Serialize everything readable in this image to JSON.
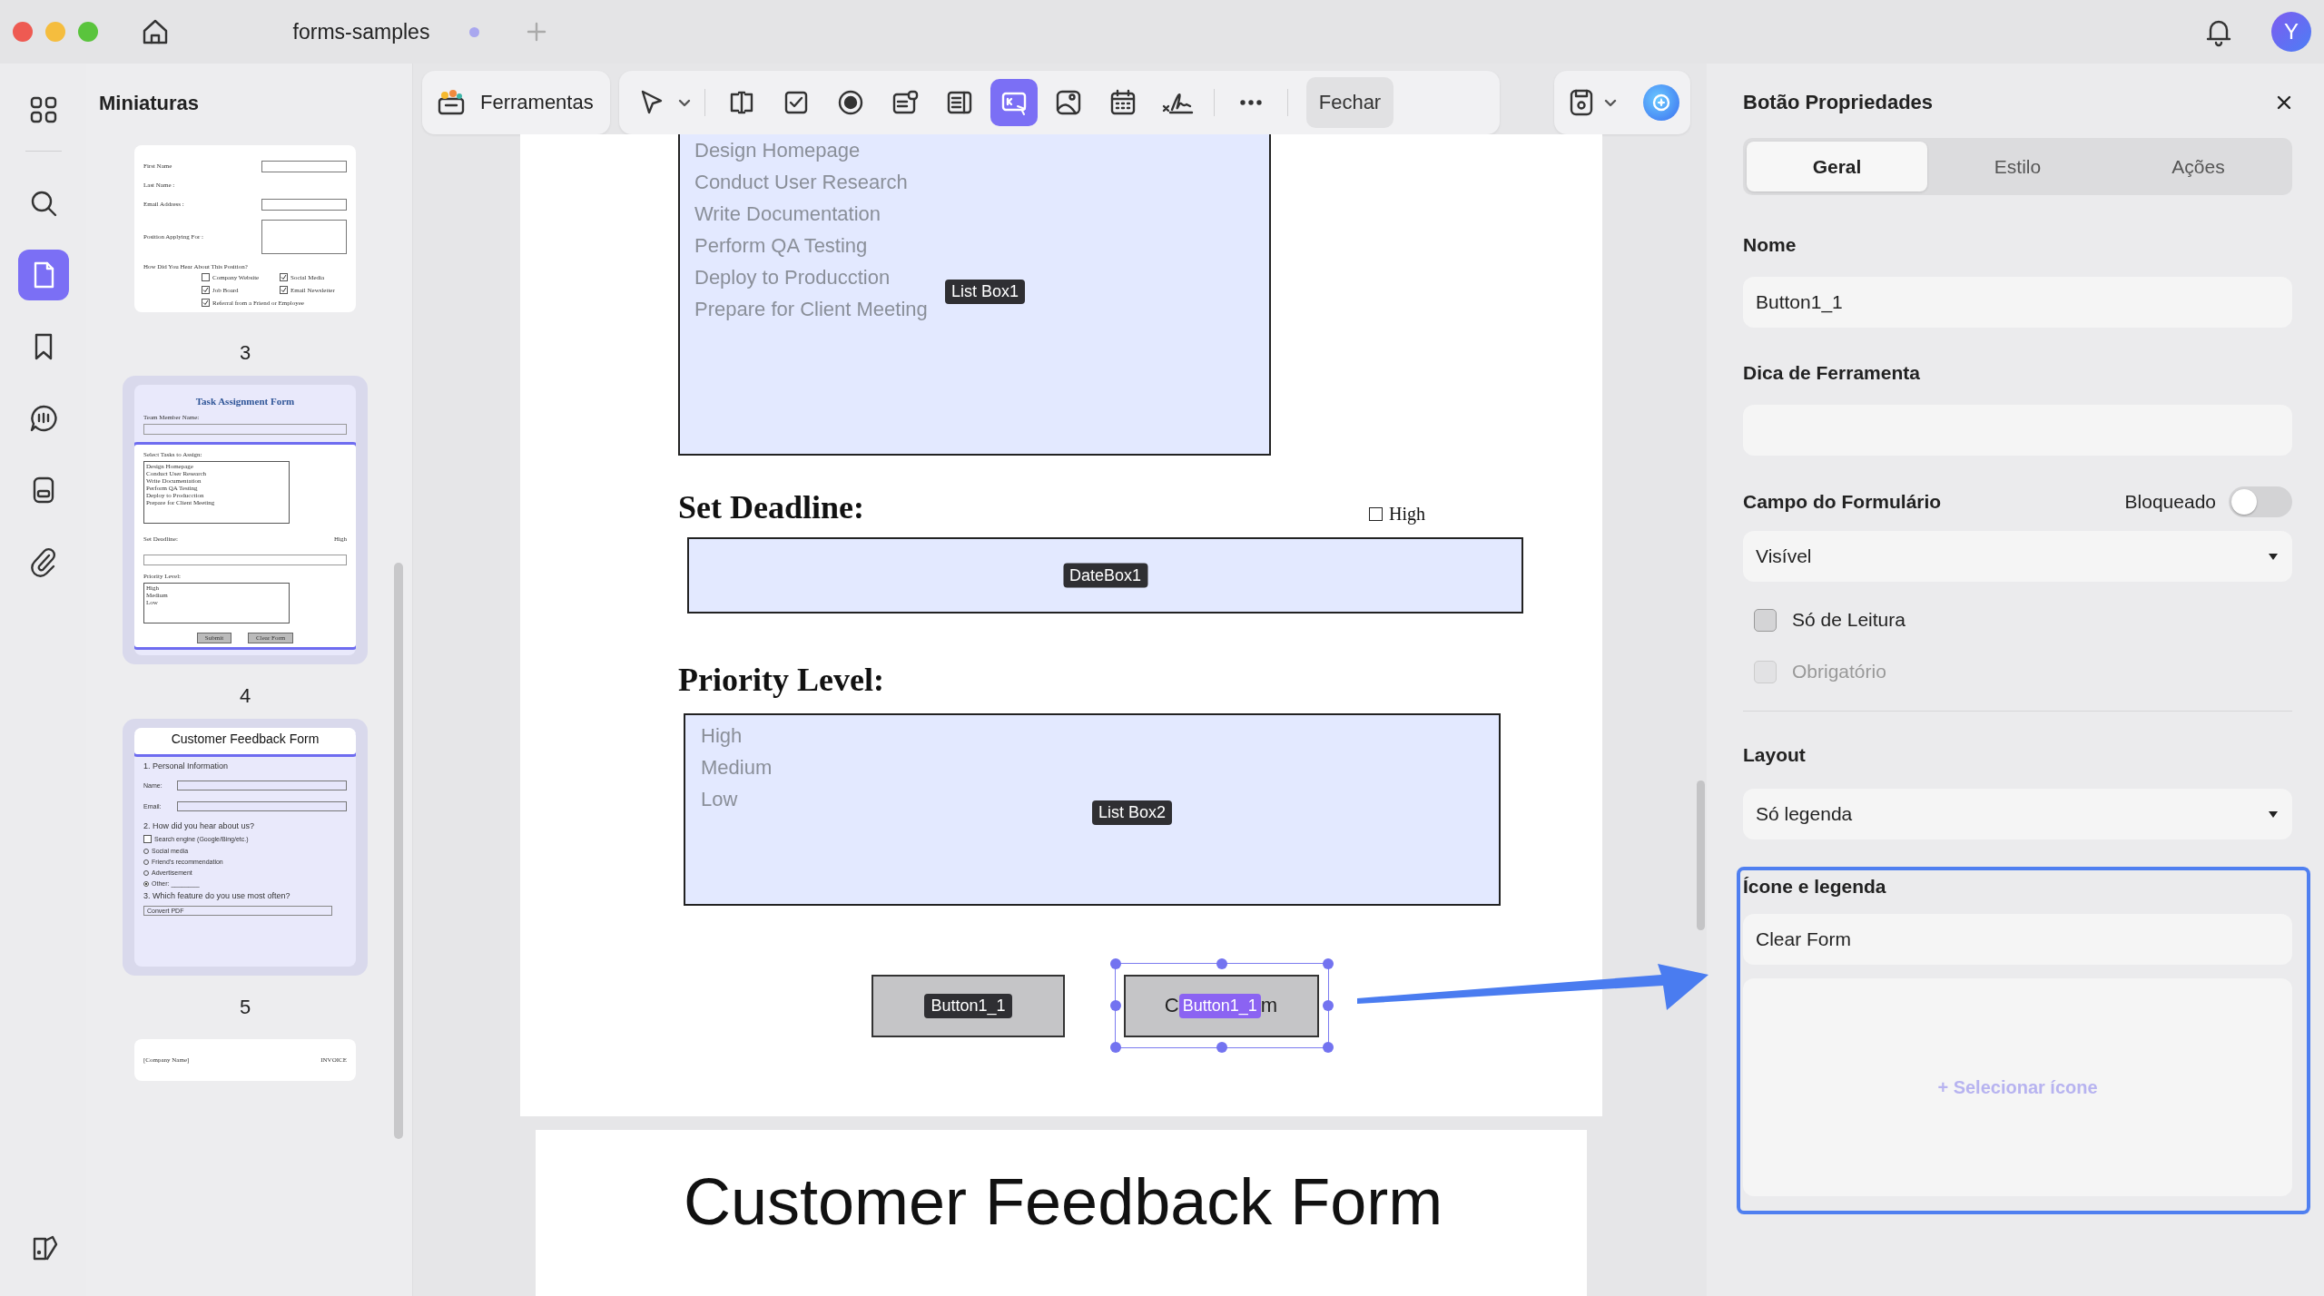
{
  "window": {
    "tab_title": "forms-samples",
    "modified": true,
    "avatar_initial": "Y"
  },
  "rail_items": [
    {
      "selected": false
    },
    {
      "selected": false
    },
    {
      "selected": true
    },
    {
      "selected": false
    },
    {
      "selected": false
    },
    {
      "selected": false
    },
    {
      "selected": false
    },
    {
      "selected": false
    }
  ],
  "thumbnails": {
    "title": "Miniaturas",
    "pages": [
      {
        "number": "3",
        "selected": false,
        "sections": [
          {
            "in_view": false,
            "items": [
              {
                "kind": "field_row",
                "text": "First Name"
              },
              {
                "kind": "text",
                "text": "Last Name :"
              },
              {
                "kind": "field_row",
                "text": "Email Address :"
              },
              {
                "kind": "area_row",
                "text": "Position Applying For :"
              },
              {
                "kind": "text",
                "text": "How Did You Hear About This Position?"
              },
              {
                "kind": "checks",
                "items": [
                  {
                    "text": "Company Website",
                    "checked": false
                  },
                  {
                    "text": "Social Media",
                    "checked": true
                  },
                  {
                    "text": "Job Board",
                    "checked": true
                  },
                  {
                    "text": "Email Newsletter",
                    "checked": true
                  },
                  {
                    "text": "Referral from a Friend or Employee",
                    "checked": true
                  }
                ]
              }
            ]
          }
        ]
      },
      {
        "number": "4",
        "selected": true,
        "sections": [
          {
            "in_view": false,
            "items": [
              {
                "kind": "title",
                "text": "Task Assignment Form"
              },
              {
                "kind": "text",
                "text": "Team Member Name:"
              },
              {
                "kind": "field"
              }
            ]
          },
          {
            "in_view": true,
            "items": [
              {
                "kind": "text",
                "text": "Select Tasks to Assign:"
              },
              {
                "kind": "listbox",
                "options": [
                  "Design Homepage",
                  "Conduct User Research",
                  "Write Documentation",
                  "Perform QA Testing",
                  "Deploy to Producction",
                  "Prepare for Client Meeting"
                ]
              },
              {
                "kind": "text_aside",
                "text": "Set Deadline:",
                "aside": "High"
              },
              {
                "kind": "field"
              },
              {
                "kind": "text",
                "text": "Priority Level:"
              },
              {
                "kind": "listbox",
                "options": [
                  "High",
                  "Medium",
                  "Low"
                ]
              },
              {
                "kind": "buttons",
                "labels": [
                  "Submit",
                  "Clear Form"
                ]
              }
            ]
          }
        ]
      },
      {
        "number": "5",
        "selected": true,
        "sections": [
          {
            "in_view": true,
            "items": [
              {
                "kind": "title",
                "text": "Customer Feedback Form"
              }
            ]
          },
          {
            "in_view": false,
            "items": [
              {
                "kind": "section",
                "text": "1. Personal Information"
              },
              {
                "kind": "field_row",
                "text": "Name:"
              },
              {
                "kind": "field_row",
                "text": "Email:"
              },
              {
                "kind": "section",
                "text": "2. How did you hear about us?"
              },
              {
                "kind": "check",
                "text": "Search engine (Google/Bing/etc.)",
                "checked": false
              },
              {
                "kind": "radio",
                "text": "Social media",
                "checked": false
              },
              {
                "kind": "radio",
                "text": "Friend's recommendation",
                "checked": false
              },
              {
                "kind": "radio",
                "text": "Advertisement",
                "checked": false
              },
              {
                "kind": "radio",
                "text": "Other: ________",
                "checked": true
              },
              {
                "kind": "section",
                "text": "3. Which feature do you use most often?"
              },
              {
                "kind": "dropdown",
                "text": "Convert PDF"
              }
            ]
          }
        ]
      },
      {
        "selected": false,
        "sections": [
          {
            "in_view": false,
            "items": [
              {
                "kind": "text_aside",
                "text": "[Company Name]",
                "aside": "INVOICE"
              }
            ]
          }
        ]
      }
    ]
  },
  "toolbar": {
    "tools_label": "Ferramentas",
    "tools": [
      {
        "selected": false
      },
      {
        "selected": false
      },
      {
        "selected": false
      },
      {
        "selected": false
      },
      {
        "selected": false
      },
      {
        "selected": false
      },
      {
        "selected": true
      },
      {
        "selected": false
      },
      {
        "selected": false
      },
      {
        "selected": false
      },
      {
        "selected": false
      }
    ],
    "close_label": "Fechar"
  },
  "document": {
    "list_box_1": {
      "items": [
        "Design Homepage",
        "Conduct User Research",
        "Write Documentation",
        "Perform QA Testing",
        "Deploy to Producction",
        "Prepare for Client Meeting"
      ],
      "badge": "List Box1"
    },
    "deadline": {
      "heading": "Set Deadline:",
      "check_label": "High",
      "checked": false,
      "badge": "DateBox1"
    },
    "priority": {
      "heading": "Priority Level:",
      "items": [
        "High",
        "Medium",
        "Low"
      ],
      "badge": "List Box2"
    },
    "buttons": [
      {
        "badge": "Button1_1",
        "selected": false
      },
      {
        "badge": "Button1_1",
        "selected": true,
        "caption_parts": [
          "C",
          "m"
        ]
      }
    ],
    "next_page_title": "Customer Feedback Form"
  },
  "properties": {
    "title": "Botão Propriedades",
    "tabs": [
      {
        "label": "Geral",
        "selected": true
      },
      {
        "label": "Estilo",
        "selected": false
      },
      {
        "label": "Ações",
        "selected": false
      }
    ],
    "name": {
      "label": "Nome",
      "value": "Button1_1"
    },
    "tooltip": {
      "label": "Dica de Ferramenta"
    },
    "form_field": {
      "label": "Campo do Formulário",
      "lock_label": "Bloqueado",
      "locked": false,
      "visibility": "Visível"
    },
    "checks": [
      {
        "label": "Só de Leitura",
        "checked": false,
        "disabled": false
      },
      {
        "label": "Obrigatório",
        "checked": false,
        "disabled": true
      }
    ],
    "layout": {
      "label": "Layout",
      "value": "Só legenda"
    },
    "icon_caption": {
      "label": "Ícone e legenda",
      "caption": "Clear Form",
      "select_icon": "+ Selecionar ícone",
      "highlighted": true
    }
  }
}
